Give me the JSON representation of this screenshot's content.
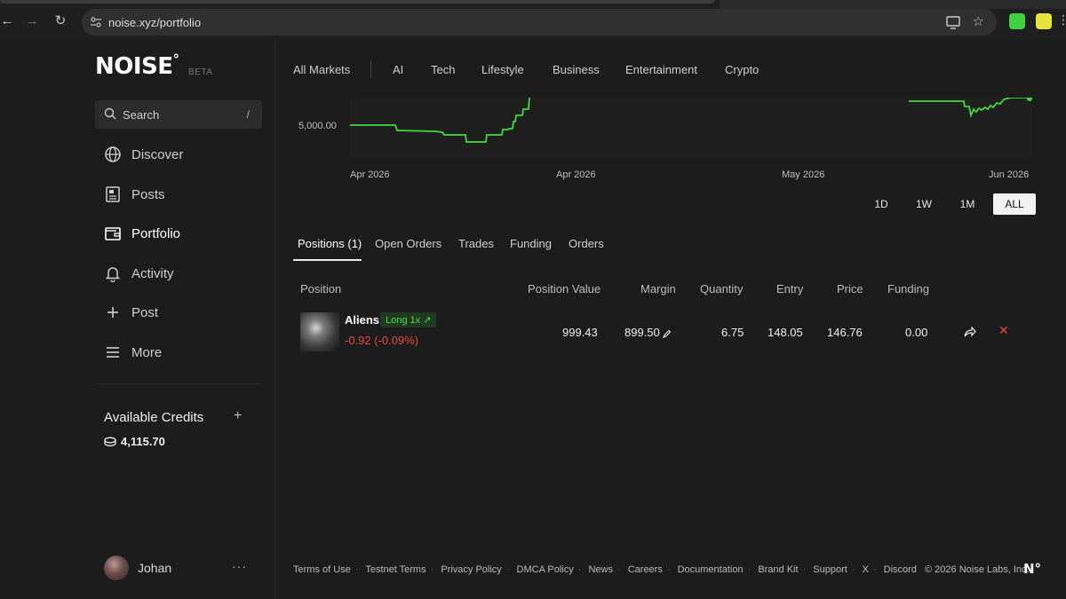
{
  "browser": {
    "url": "noise.xyz/portfolio"
  },
  "brand": {
    "logo": "NOISE",
    "badge": "BETA"
  },
  "search": {
    "label": "Search",
    "shortcut": "/"
  },
  "sidebar": {
    "items": [
      {
        "label": "Discover",
        "icon": "globe-icon"
      },
      {
        "label": "Posts",
        "icon": "newspaper-icon"
      },
      {
        "label": "Portfolio",
        "icon": "wallet-icon",
        "active": true
      },
      {
        "label": "Activity",
        "icon": "bell-icon"
      },
      {
        "label": "Post",
        "icon": "plus-icon"
      },
      {
        "label": "More",
        "icon": "menu-icon"
      }
    ],
    "credits_title": "Available Credits",
    "credits_add": "+",
    "credits_value": "4,115.70",
    "user_name": "Johan",
    "user_more": "···"
  },
  "categories": [
    "All Markets",
    "AI",
    "Tech",
    "Lifestyle",
    "Business",
    "Entertainment",
    "Crypto"
  ],
  "chart_data": {
    "type": "line",
    "y_tick_label": "5,000.00",
    "x_labels": [
      "Apr 2026",
      "Apr 2026",
      "May 2026",
      "Jun 2026"
    ],
    "color": "#3ddc3d"
  },
  "ranges": [
    "1D",
    "1W",
    "1M",
    "ALL"
  ],
  "active_range": "ALL",
  "subtabs": [
    "Positions (1)",
    "Open Orders",
    "Trades",
    "Funding",
    "Orders"
  ],
  "table": {
    "headers": [
      "Position",
      "Position Value",
      "Margin",
      "Quantity",
      "Entry",
      "Price",
      "Funding"
    ],
    "rows": [
      {
        "name": "Aliens",
        "badge": "Long 1x ↗",
        "pnl": "-0.92 (-0.09%)",
        "position_value": "999.43",
        "margin": "899.50",
        "quantity": "6.75",
        "entry": "148.05",
        "price": "146.76",
        "funding": "0.00"
      }
    ]
  },
  "footer": {
    "links": [
      "Terms of Use",
      "Testnet Terms",
      "Privacy Policy",
      "DMCA Policy",
      "News",
      "Careers",
      "Documentation",
      "Brand Kit",
      "Support",
      "X",
      "Discord"
    ],
    "copyright": "© 2026 Noise Labs, Inc.",
    "logo": "N°"
  },
  "colors": {
    "accent_green": "#3ddc3d",
    "loss_red": "#ef4444",
    "background": "#1c1c1c"
  }
}
